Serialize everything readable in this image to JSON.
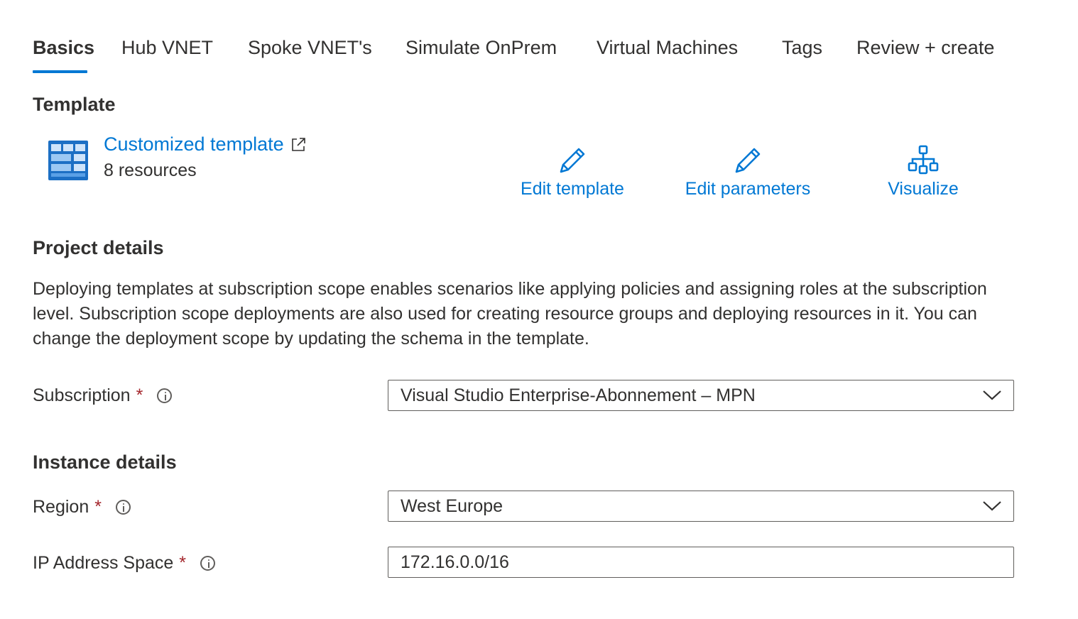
{
  "tabs": [
    {
      "label": "Basics",
      "active": true
    },
    {
      "label": "Hub VNET"
    },
    {
      "label": "Spoke VNET's"
    },
    {
      "label": "Simulate OnPrem"
    },
    {
      "label": "Virtual Machines"
    },
    {
      "label": "Tags"
    },
    {
      "label": "Review + create"
    }
  ],
  "template": {
    "section_title": "Template",
    "name": "Customized template",
    "resources": "8 resources",
    "icon": "template-grid-icon",
    "actions": [
      {
        "label": "Edit template",
        "icon": "pencil-icon"
      },
      {
        "label": "Edit parameters",
        "icon": "pencil-icon"
      },
      {
        "label": "Visualize",
        "icon": "hierarchy-icon"
      }
    ]
  },
  "project": {
    "section_title": "Project details",
    "description": "Deploying templates at subscription scope enables scenarios like applying policies and assigning roles at the subscription level. Subscription scope deployments are also used for creating resource groups and deploying resources in it. You can change the deployment scope by updating the schema in the template.",
    "subscription_label": "Subscription",
    "subscription_value": "Visual Studio Enterprise-Abonnement – MPN"
  },
  "instance": {
    "section_title": "Instance details",
    "region_label": "Region",
    "region_value": "West Europe",
    "ip_label": "IP Address Space",
    "ip_value": "172.16.0.0/16"
  },
  "required_marker": "*",
  "colors": {
    "accent": "#0078d4",
    "required": "#a4262c",
    "text": "#323130",
    "border": "#605e5c"
  }
}
